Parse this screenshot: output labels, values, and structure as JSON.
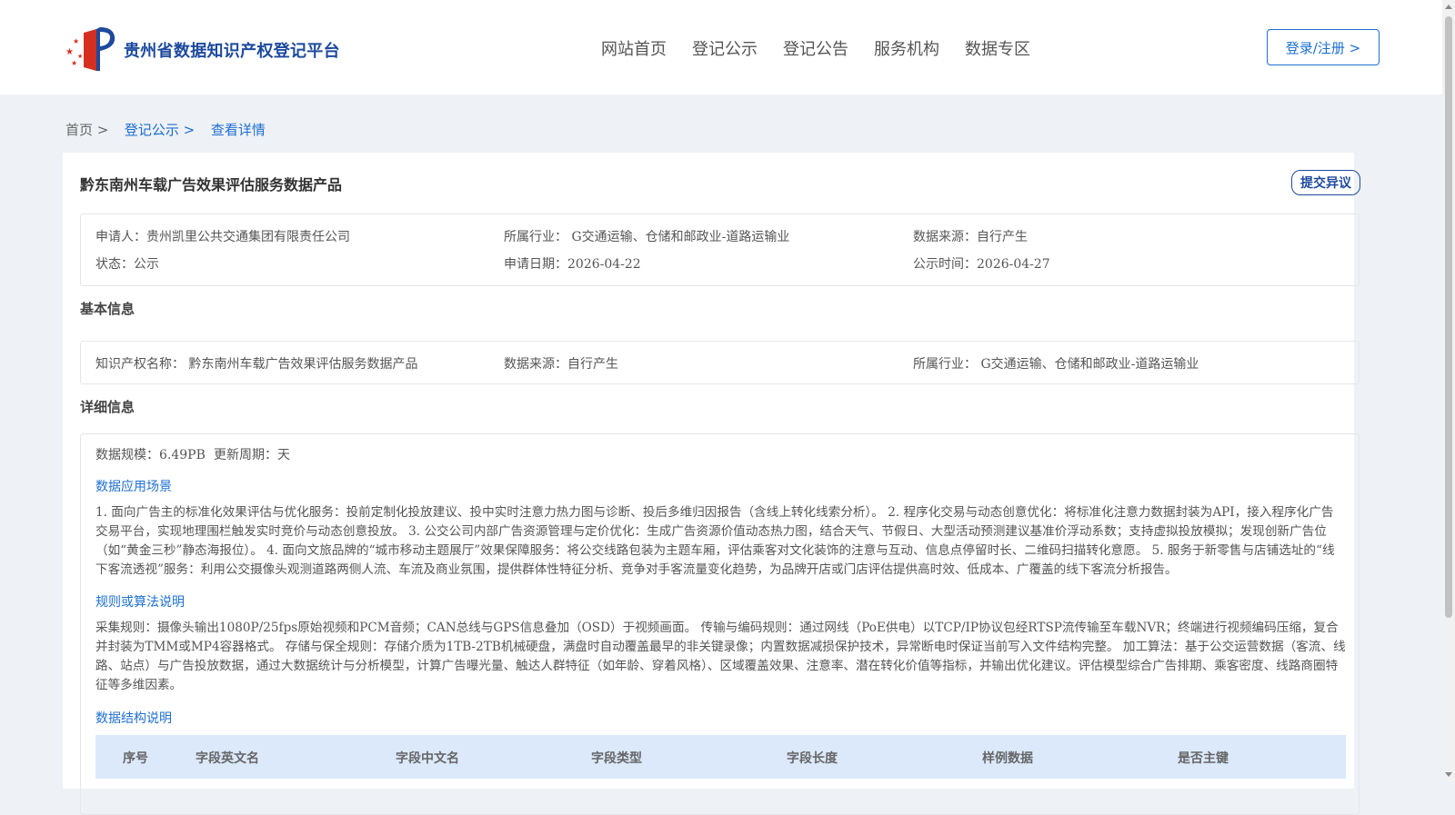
{
  "header": {
    "site_title": "贵州省数据知识产权登记平台",
    "nav": [
      "网站首页",
      "登记公示",
      "登记公告",
      "服务机构",
      "数据专区"
    ],
    "login_label": "登录/注册 >"
  },
  "breadcrumb": {
    "home": "首页 >",
    "level2": "登记公示 >",
    "level3": "查看详情"
  },
  "product": {
    "title": "黔东南州车载广告效果评估服务数据产品",
    "objection_label": "提交异议"
  },
  "summary": {
    "applicant": "申请人：贵州凯里公共交通集团有限责任公司",
    "industry": "所属行业： G交通运输、仓储和邮政业-道路运输业",
    "data_source": "数据来源：自行产生",
    "status": "状态：公示",
    "apply_date": "申请日期：2026-04-22",
    "publish_date": "公示时间：2026-04-27"
  },
  "basic": {
    "heading": "基本信息",
    "ip_name": "知识产权名称： 黔东南州车载广告效果评估服务数据产品",
    "data_source": "数据来源：自行产生",
    "industry": "所属行业： G交通运输、仓储和邮政业-道路运输业"
  },
  "detail": {
    "heading": "详细信息",
    "scale": "数据规模：6.49PB",
    "update_cycle": "更新周期：天",
    "scenario_heading": "数据应用场景",
    "scenario_text": "1. 面向广告主的标准化效果评估与优化服务：投前定制化投放建议、投中实时注意力热力图与诊断、投后多维归因报告（含线上转化线索分析）。 2. 程序化交易与动态创意优化：将标准化注意力数据封装为API，接入程序化广告交易平台，实现地理围栏触发实时竞价与动态创意投放。 3. 公交公司内部广告资源管理与定价优化：生成广告资源价值动态热力图，结合天气、节假日、大型活动预测建议基准价浮动系数；支持虚拟投放模拟；发现创新广告位（如“黄金三秒”静态海报位）。 4. 面向文旅品牌的“城市移动主题展厅”效果保障服务：将公交线路包装为主题车厢，评估乘客对文化装饰的注意与互动、信息点停留时长、二维码扫描转化意愿。 5. 服务于新零售与店铺选址的“线下客流透视”服务：利用公交摄像头观测道路两侧人流、车流及商业氛围，提供群体性特征分析、竞争对手客流量变化趋势，为品牌开店或门店评估提供高时效、低成本、广覆盖的线下客流分析报告。",
    "rules_heading": "规则或算法说明",
    "rules_text": "采集规则：摄像头输出1080P/25fps原始视频和PCM音频；CAN总线与GPS信息叠加（OSD）于视频画面。 传输与编码规则：通过网线（PoE供电）以TCP/IP协议包经RTSP流传输至车载NVR；终端进行视频编码压缩，复合并封装为TMM或MP4容器格式。 存储与保全规则：存储介质为1TB-2TB机械硬盘，满盘时自动覆盖最早的非关键录像；内置数据减损保护技术，异常断电时保证当前写入文件结构完整。 加工算法：基于公交运营数据（客流、线路、站点）与广告投放数据，通过大数据统计与分析模型，计算广告曝光量、触达人群特征（如年龄、穿着风格）、区域覆盖效果、注意率、潜在转化价值等指标，并输出优化建议。评估模型综合广告排期、乘客密度、线路商圈特征等多维因素。",
    "structure_heading": "数据结构说明",
    "table_headers": [
      "序号",
      "字段英文名",
      "字段中文名",
      "字段类型",
      "字段长度",
      "样例数据",
      "是否主键"
    ]
  },
  "colors": {
    "brand_blue": "#1d4a9e",
    "link_blue": "#1d6fd0",
    "table_header_bg": "#dbe9fb"
  }
}
